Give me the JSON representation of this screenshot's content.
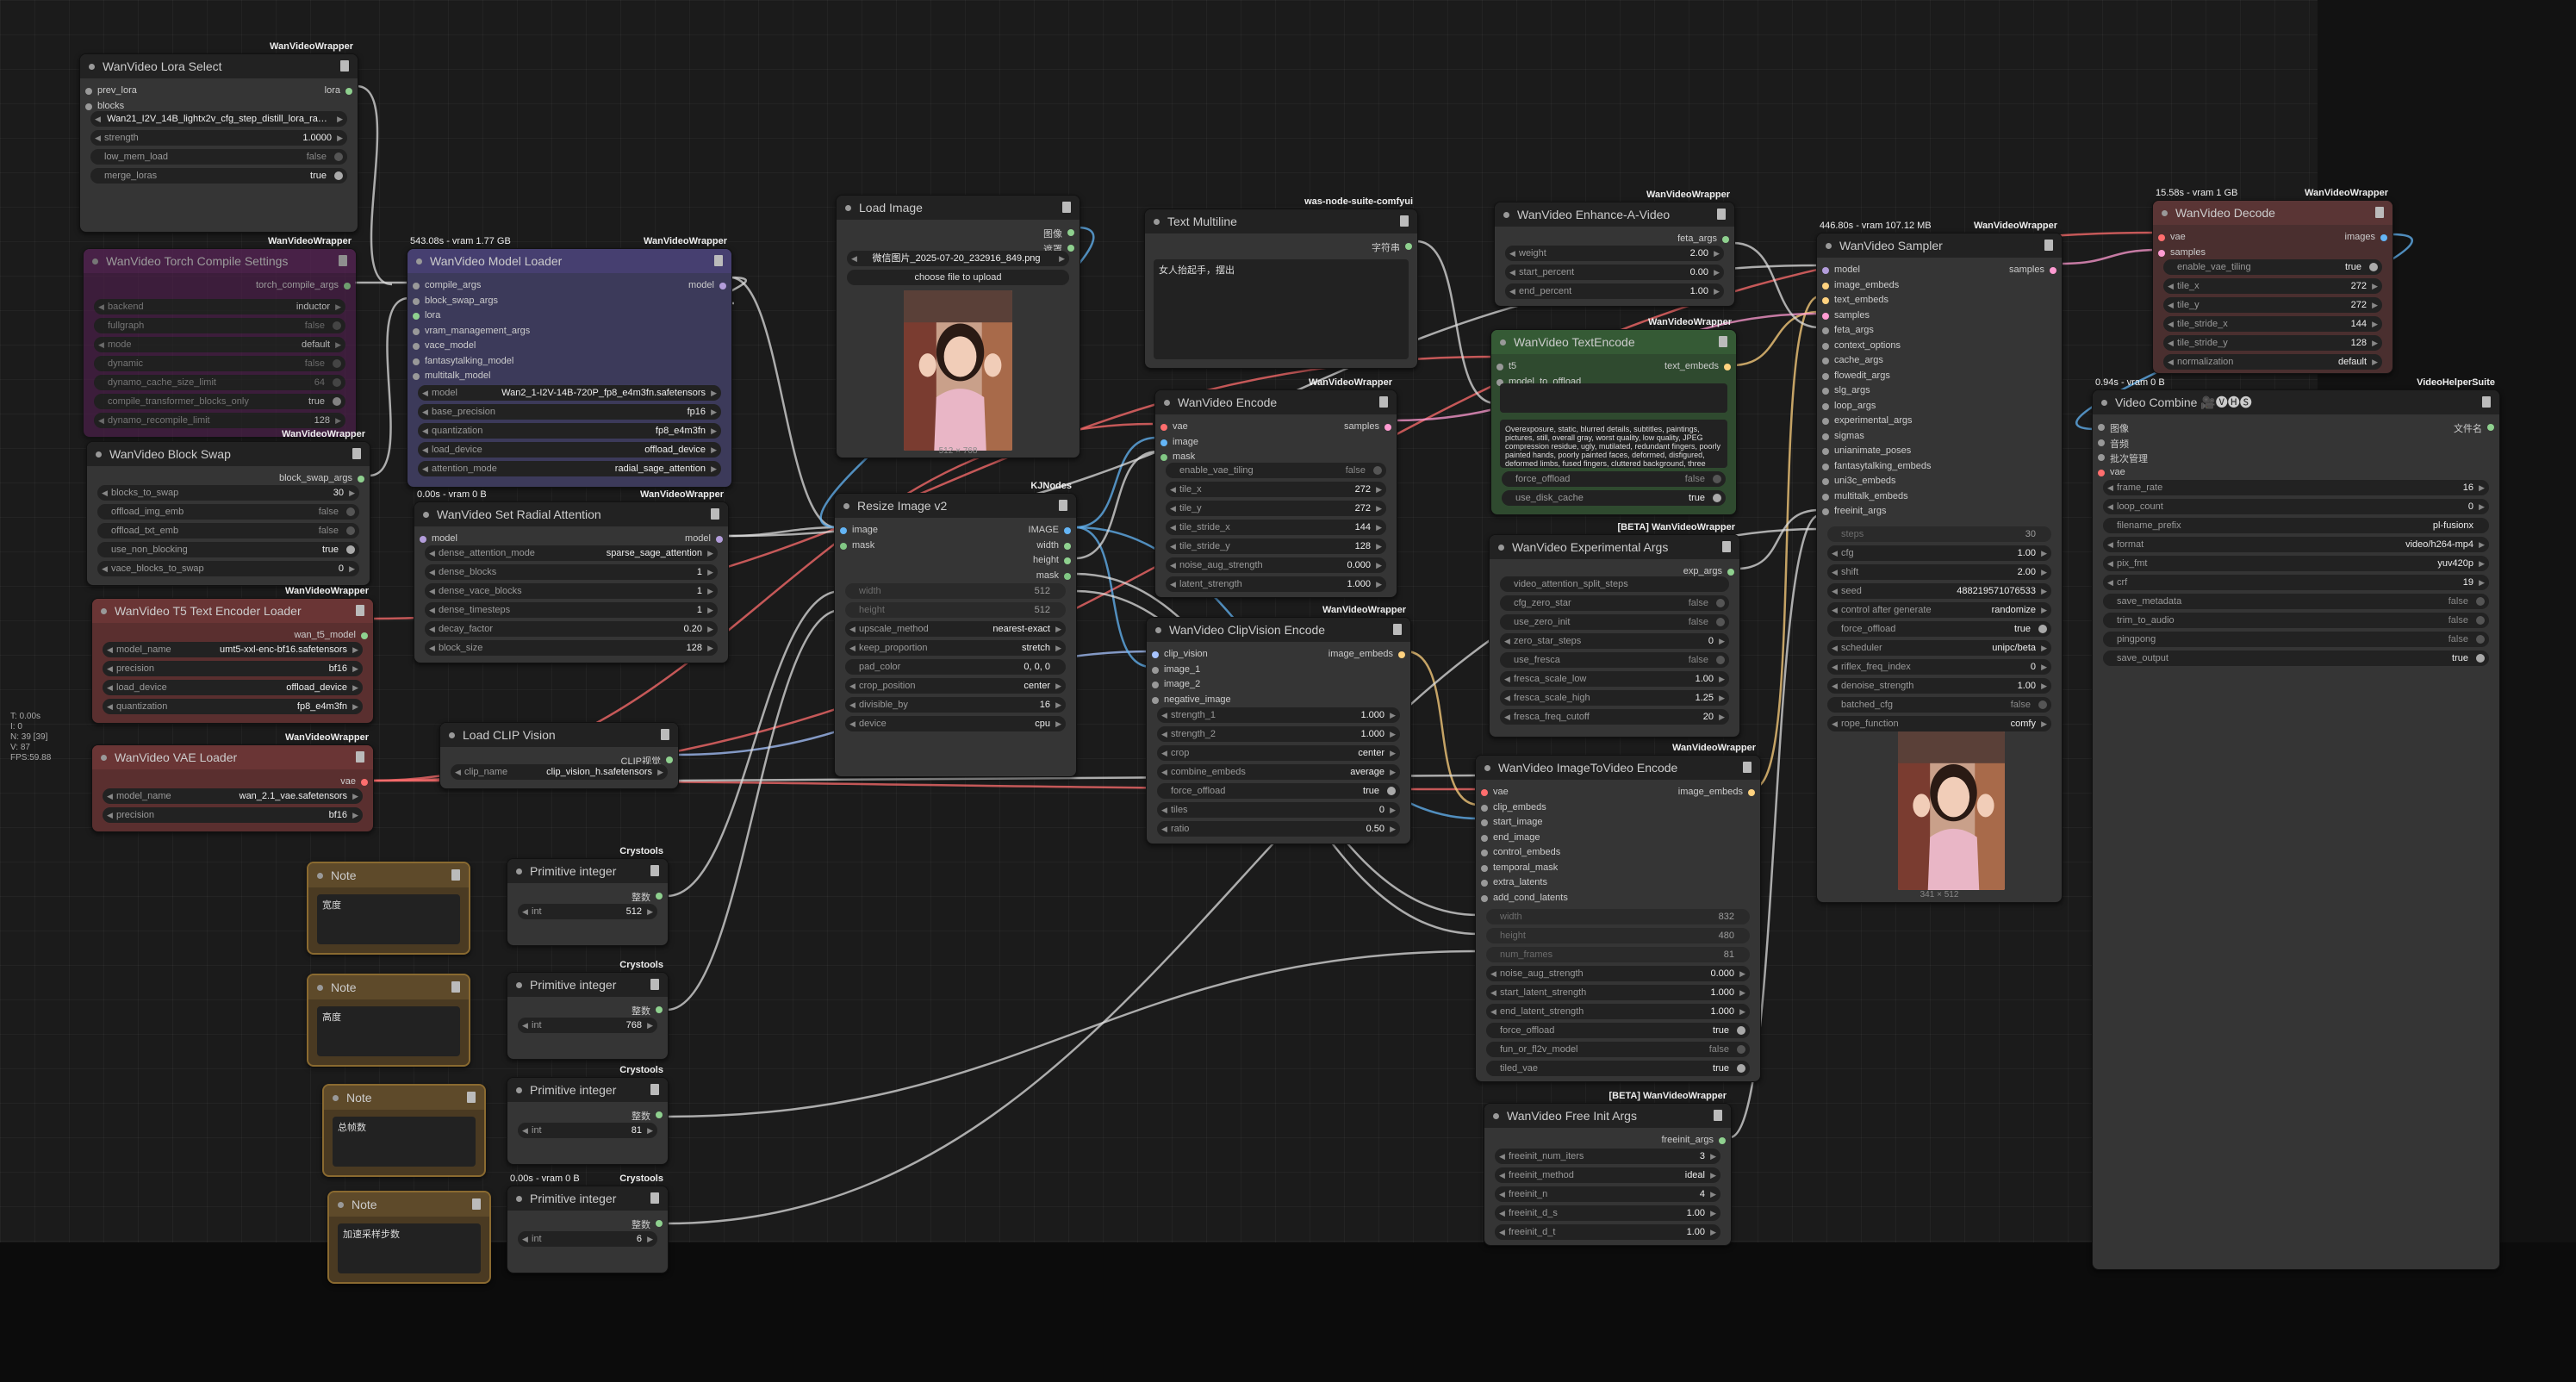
{
  "stats": [
    "T: 0.00s",
    "I: 0",
    "N: 39 [39]",
    "V: 87",
    "FPS:59.88"
  ],
  "nodes": {
    "lora": {
      "title": "WanVideo Lora Select",
      "tag": "WanVideoWrapper",
      "in": [
        "prev_lora",
        "blocks"
      ],
      "out": [
        "lora"
      ],
      "widgets": [
        {
          "t": "combo",
          "k": "",
          "v": "Wan21_I2V_14B_lightx2v_cfg_step_distill_lora_ra…"
        },
        {
          "t": "num",
          "k": "strength",
          "v": "1.0000"
        },
        {
          "t": "toggle",
          "k": "low_mem_load",
          "v": "false"
        },
        {
          "t": "toggle",
          "k": "merge_loras",
          "v": "true"
        }
      ]
    },
    "torch": {
      "title": "WanVideo Torch Compile Settings",
      "tag": "WanVideoWrapper",
      "out": [
        "torch_compile_args"
      ],
      "widgets": [
        {
          "t": "combo",
          "k": "backend",
          "v": "inductor"
        },
        {
          "t": "toggle",
          "k": "fullgraph",
          "v": "false"
        },
        {
          "t": "combo",
          "k": "mode",
          "v": "default"
        },
        {
          "t": "toggle",
          "k": "dynamic",
          "v": "false"
        },
        {
          "t": "toggle",
          "k": "dynamo_cache_size_limit",
          "v": "64"
        },
        {
          "t": "toggle",
          "k": "compile_transformer_blocks_only",
          "v": "true"
        },
        {
          "t": "num",
          "k": "dynamo_recompile_limit",
          "v": "128"
        }
      ]
    },
    "blockswap": {
      "title": "WanVideo Block Swap",
      "tag": "WanVideoWrapper",
      "out": [
        "block_swap_args"
      ],
      "widgets": [
        {
          "t": "num",
          "k": "blocks_to_swap",
          "v": "30"
        },
        {
          "t": "toggle",
          "k": "offload_img_emb",
          "v": "false"
        },
        {
          "t": "toggle",
          "k": "offload_txt_emb",
          "v": "false"
        },
        {
          "t": "toggle",
          "k": "use_non_blocking",
          "v": "true"
        },
        {
          "t": "num",
          "k": "vace_blocks_to_swap",
          "v": "0"
        }
      ]
    },
    "t5": {
      "title": "WanVideo T5 Text Encoder Loader",
      "tag": "WanVideoWrapper",
      "out": [
        "wan_t5_model"
      ],
      "widgets": [
        {
          "t": "combo",
          "k": "model_name",
          "v": "umt5-xxl-enc-bf16.safetensors"
        },
        {
          "t": "combo",
          "k": "precision",
          "v": "bf16"
        },
        {
          "t": "combo",
          "k": "load_device",
          "v": "offload_device"
        },
        {
          "t": "combo",
          "k": "quantization",
          "v": "fp8_e4m3fn"
        }
      ]
    },
    "vae": {
      "title": "WanVideo VAE Loader",
      "tag": "WanVideoWrapper",
      "out": [
        "vae"
      ],
      "widgets": [
        {
          "t": "combo",
          "k": "model_name",
          "v": "wan_2.1_vae.safetensors"
        },
        {
          "t": "combo",
          "k": "precision",
          "v": "bf16"
        }
      ]
    },
    "model": {
      "title": "WanVideo Model Loader",
      "tag": "WanVideoWrapper",
      "time": "543.08s - vram 1.77 GB",
      "in": [
        "compile_args",
        "block_swap_args",
        "lora",
        "vram_management_args",
        "vace_model",
        "fantasytalking_model",
        "multitalk_model"
      ],
      "out": [
        "model"
      ],
      "widgets": [
        {
          "t": "combo",
          "k": "model",
          "v": "Wan2_1-I2V-14B-720P_fp8_e4m3fn.safetensors"
        },
        {
          "t": "combo",
          "k": "base_precision",
          "v": "fp16"
        },
        {
          "t": "combo",
          "k": "quantization",
          "v": "fp8_e4m3fn"
        },
        {
          "t": "combo",
          "k": "load_device",
          "v": "offload_device"
        },
        {
          "t": "combo",
          "k": "attention_mode",
          "v": "radial_sage_attention"
        }
      ]
    },
    "radial": {
      "title": "WanVideo Set Radial Attention",
      "tag": "WanVideoWrapper",
      "time": "0.00s - vram 0 B",
      "in": [
        "model"
      ],
      "out": [
        "model"
      ],
      "widgets": [
        {
          "t": "combo",
          "k": "dense_attention_mode",
          "v": "sparse_sage_attention"
        },
        {
          "t": "num",
          "k": "dense_blocks",
          "v": "1"
        },
        {
          "t": "num",
          "k": "dense_vace_blocks",
          "v": "1"
        },
        {
          "t": "num",
          "k": "dense_timesteps",
          "v": "1"
        },
        {
          "t": "num",
          "k": "decay_factor",
          "v": "0.20"
        },
        {
          "t": "num",
          "k": "block_size",
          "v": "128"
        }
      ]
    },
    "clip": {
      "title": "Load CLIP Vision",
      "out": [
        "CLIP视觉"
      ],
      "widgets": [
        {
          "t": "combo",
          "k": "clip_name",
          "v": "clip_vision_h.safetensors"
        }
      ]
    },
    "loadimg": {
      "title": "Load Image",
      "out": [
        "图像",
        "遮罩"
      ],
      "widgets": [
        {
          "t": "combo",
          "k": "",
          "v": "微信图片_2025-07-20_232916_849.png"
        },
        {
          "t": "btn",
          "k": "choose file to upload",
          "v": ""
        }
      ],
      "caption": "512 × 768"
    },
    "resize": {
      "title": "Resize Image v2",
      "tag": "KJNodes",
      "in": [
        "image",
        "mask"
      ],
      "out": [
        "IMAGE",
        "width",
        "height",
        "mask"
      ],
      "widgets": [
        {
          "t": "faded",
          "k": "width",
          "v": "512"
        },
        {
          "t": "faded",
          "k": "height",
          "v": "512"
        },
        {
          "t": "combo",
          "k": "upscale_method",
          "v": "nearest-exact"
        },
        {
          "t": "combo",
          "k": "keep_proportion",
          "v": "stretch"
        },
        {
          "t": "text",
          "k": "pad_color",
          "v": "0, 0, 0"
        },
        {
          "t": "combo",
          "k": "crop_position",
          "v": "center"
        },
        {
          "t": "num",
          "k": "divisible_by",
          "v": "16"
        },
        {
          "t": "combo",
          "k": "device",
          "v": "cpu"
        }
      ]
    },
    "textml": {
      "title": "Text Multiline",
      "tag": "was-node-suite-comfyui",
      "out": [
        "字符串"
      ],
      "text": "女人抬起手，摆出"
    },
    "encode": {
      "title": "WanVideo Encode",
      "tag": "WanVideoWrapper",
      "in": [
        "vae",
        "image",
        "mask"
      ],
      "out": [
        "samples"
      ],
      "widgets": [
        {
          "t": "toggle",
          "k": "enable_vae_tiling",
          "v": "false"
        },
        {
          "t": "num",
          "k": "tile_x",
          "v": "272"
        },
        {
          "t": "num",
          "k": "tile_y",
          "v": "272"
        },
        {
          "t": "num",
          "k": "tile_stride_x",
          "v": "144"
        },
        {
          "t": "num",
          "k": "tile_stride_y",
          "v": "128"
        },
        {
          "t": "num",
          "k": "noise_aug_strength",
          "v": "0.000"
        },
        {
          "t": "num",
          "k": "latent_strength",
          "v": "1.000"
        }
      ]
    },
    "clipenc": {
      "title": "WanVideo ClipVision Encode",
      "tag": "WanVideoWrapper",
      "in": [
        "clip_vision",
        "image_1",
        "image_2",
        "negative_image"
      ],
      "out": [
        "image_embeds"
      ],
      "widgets": [
        {
          "t": "num",
          "k": "strength_1",
          "v": "1.000"
        },
        {
          "t": "num",
          "k": "strength_2",
          "v": "1.000"
        },
        {
          "t": "combo",
          "k": "crop",
          "v": "center"
        },
        {
          "t": "combo",
          "k": "combine_embeds",
          "v": "average"
        },
        {
          "t": "toggle",
          "k": "force_offload",
          "v": "true"
        },
        {
          "t": "num",
          "k": "tiles",
          "v": "0"
        },
        {
          "t": "num",
          "k": "ratio",
          "v": "0.50"
        }
      ]
    },
    "enhance": {
      "title": "WanVideo Enhance-A-Video",
      "tag": "WanVideoWrapper",
      "out": [
        "feta_args"
      ],
      "widgets": [
        {
          "t": "num",
          "k": "weight",
          "v": "2.00"
        },
        {
          "t": "num",
          "k": "start_percent",
          "v": "0.00"
        },
        {
          "t": "num",
          "k": "end_percent",
          "v": "1.00"
        }
      ]
    },
    "textenc": {
      "title": "WanVideo TextEncode",
      "tag": "WanVideoWrapper",
      "in": [
        "t5",
        "model_to_offload"
      ],
      "out": [
        "text_embeds"
      ],
      "neg": "Overexposure, static, blurred details, subtitles, paintings, pictures, still, overall gray, worst quality, low quality, JPEG compression residue, ugly, mutilated, redundant fingers, poorly painted hands, poorly painted faces, deformed, disfigured, deformed limbs, fused fingers, cluttered background, three legs, a lot of people in the background, upside down",
      "widgets": [
        {
          "t": "toggle",
          "k": "force_offload",
          "v": "false"
        },
        {
          "t": "toggle",
          "k": "use_disk_cache",
          "v": "true"
        }
      ]
    },
    "exp": {
      "title": "WanVideo Experimental Args",
      "tag": "[BETA] WanVideoWrapper",
      "out": [
        "exp_args"
      ],
      "widgets": [
        {
          "t": "text",
          "k": "video_attention_split_steps",
          "v": ""
        },
        {
          "t": "toggle",
          "k": "cfg_zero_star",
          "v": "false"
        },
        {
          "t": "toggle",
          "k": "use_zero_init",
          "v": "false"
        },
        {
          "t": "num",
          "k": "zero_star_steps",
          "v": "0"
        },
        {
          "t": "toggle",
          "k": "use_fresca",
          "v": "false"
        },
        {
          "t": "num",
          "k": "fresca_scale_low",
          "v": "1.00"
        },
        {
          "t": "num",
          "k": "fresca_scale_high",
          "v": "1.25"
        },
        {
          "t": "num",
          "k": "fresca_freq_cutoff",
          "v": "20"
        }
      ]
    },
    "i2v": {
      "title": "WanVideo ImageToVideo Encode",
      "tag": "WanVideoWrapper",
      "in": [
        "vae",
        "clip_embeds",
        "start_image",
        "end_image",
        "control_embeds",
        "temporal_mask",
        "extra_latents",
        "add_cond_latents"
      ],
      "out": [
        "image_embeds"
      ],
      "widgets": [
        {
          "t": "faded",
          "k": "width",
          "v": "832"
        },
        {
          "t": "faded",
          "k": "height",
          "v": "480"
        },
        {
          "t": "faded",
          "k": "num_frames",
          "v": "81"
        },
        {
          "t": "num",
          "k": "noise_aug_strength",
          "v": "0.000"
        },
        {
          "t": "num",
          "k": "start_latent_strength",
          "v": "1.000"
        },
        {
          "t": "num",
          "k": "end_latent_strength",
          "v": "1.000"
        },
        {
          "t": "toggle",
          "k": "force_offload",
          "v": "true"
        },
        {
          "t": "toggle",
          "k": "fun_or_fl2v_model",
          "v": "false"
        },
        {
          "t": "toggle",
          "k": "tiled_vae",
          "v": "true"
        }
      ]
    },
    "freeinit": {
      "title": "WanVideo Free Init Args",
      "tag": "[BETA] WanVideoWrapper",
      "out": [
        "freeinit_args"
      ],
      "widgets": [
        {
          "t": "num",
          "k": "freeinit_num_iters",
          "v": "3"
        },
        {
          "t": "combo",
          "k": "freeinit_method",
          "v": "ideal"
        },
        {
          "t": "num",
          "k": "freeinit_n",
          "v": "4"
        },
        {
          "t": "num",
          "k": "freeinit_d_s",
          "v": "1.00"
        },
        {
          "t": "num",
          "k": "freeinit_d_t",
          "v": "1.00"
        }
      ]
    },
    "sampler": {
      "title": "WanVideo Sampler",
      "tag": "WanVideoWrapper",
      "time": "446.80s - vram 107.12 MB",
      "in": [
        "model",
        "image_embeds",
        "text_embeds",
        "samples",
        "feta_args",
        "context_options",
        "cache_args",
        "flowedit_args",
        "slg_args",
        "loop_args",
        "experimental_args",
        "sigmas",
        "unianimate_poses",
        "fantasytalking_embeds",
        "uni3c_embeds",
        "multitalk_embeds",
        "freeinit_args"
      ],
      "out": [
        "samples"
      ],
      "widgets": [
        {
          "t": "faded",
          "k": "steps",
          "v": "30"
        },
        {
          "t": "num",
          "k": "cfg",
          "v": "1.00"
        },
        {
          "t": "num",
          "k": "shift",
          "v": "2.00"
        },
        {
          "t": "num",
          "k": "seed",
          "v": "488219571076533"
        },
        {
          "t": "combo",
          "k": "control after generate",
          "v": "randomize"
        },
        {
          "t": "toggle",
          "k": "force_offload",
          "v": "true"
        },
        {
          "t": "combo",
          "k": "scheduler",
          "v": "unipc/beta"
        },
        {
          "t": "num",
          "k": "riflex_freq_index",
          "v": "0"
        },
        {
          "t": "num",
          "k": "denoise_strength",
          "v": "1.00"
        },
        {
          "t": "toggle",
          "k": "batched_cfg",
          "v": "false"
        },
        {
          "t": "combo",
          "k": "rope_function",
          "v": "comfy"
        }
      ],
      "caption": "341 × 512"
    },
    "decode": {
      "title": "WanVideo Decode",
      "tag": "WanVideoWrapper",
      "time": "15.58s - vram 1 GB",
      "in": [
        "vae",
        "samples"
      ],
      "out": [
        "images"
      ],
      "widgets": [
        {
          "t": "toggle",
          "k": "enable_vae_tiling",
          "v": "true"
        },
        {
          "t": "num",
          "k": "tile_x",
          "v": "272"
        },
        {
          "t": "num",
          "k": "tile_y",
          "v": "272"
        },
        {
          "t": "num",
          "k": "tile_stride_x",
          "v": "144"
        },
        {
          "t": "num",
          "k": "tile_stride_y",
          "v": "128"
        },
        {
          "t": "combo",
          "k": "normalization",
          "v": "default"
        }
      ]
    },
    "combine": {
      "title": "Video Combine 🎥🅥🅗🅢",
      "tag": "VideoHelperSuite",
      "time": "0.94s - vram 0 B",
      "in": [
        "图像",
        "音频",
        "批次管理",
        "vae"
      ],
      "out": [
        "文件名"
      ],
      "widgets": [
        {
          "t": "num",
          "k": "frame_rate",
          "v": "16"
        },
        {
          "t": "num",
          "k": "loop_count",
          "v": "0"
        },
        {
          "t": "text",
          "k": "filename_prefix",
          "v": "pl-fusionx"
        },
        {
          "t": "combo",
          "k": "format",
          "v": "video/h264-mp4"
        },
        {
          "t": "combo",
          "k": "pix_fmt",
          "v": "yuv420p"
        },
        {
          "t": "num",
          "k": "crf",
          "v": "19"
        },
        {
          "t": "toggle",
          "k": "save_metadata",
          "v": "false"
        },
        {
          "t": "toggle",
          "k": "trim_to_audio",
          "v": "false"
        },
        {
          "t": "toggle",
          "k": "pingpong",
          "v": "false"
        },
        {
          "t": "toggle",
          "k": "save_output",
          "v": "true"
        }
      ]
    },
    "note1": {
      "title": "Note",
      "text": "宽度"
    },
    "note2": {
      "title": "Note",
      "text": "高度"
    },
    "note3": {
      "title": "Note",
      "text": "总帧数"
    },
    "note4": {
      "title": "Note",
      "text": "加速采样步数"
    },
    "prim1": {
      "title": "Primitive integer",
      "tag": "Crystools",
      "out": [
        "整数"
      ],
      "widgets": [
        {
          "t": "num",
          "k": "int",
          "v": "512"
        }
      ]
    },
    "prim2": {
      "title": "Primitive integer",
      "tag": "Crystools",
      "out": [
        "整数"
      ],
      "widgets": [
        {
          "t": "num",
          "k": "int",
          "v": "768"
        }
      ]
    },
    "prim3": {
      "title": "Primitive integer",
      "tag": "Crystools",
      "out": [
        "整数"
      ],
      "widgets": [
        {
          "t": "num",
          "k": "int",
          "v": "81"
        }
      ]
    },
    "prim4": {
      "title": "Primitive integer",
      "tag": "Crystools",
      "time": "0.00s - vram 0 B",
      "out": [
        "整数"
      ],
      "widgets": [
        {
          "t": "num",
          "k": "int",
          "v": "6"
        }
      ]
    }
  }
}
